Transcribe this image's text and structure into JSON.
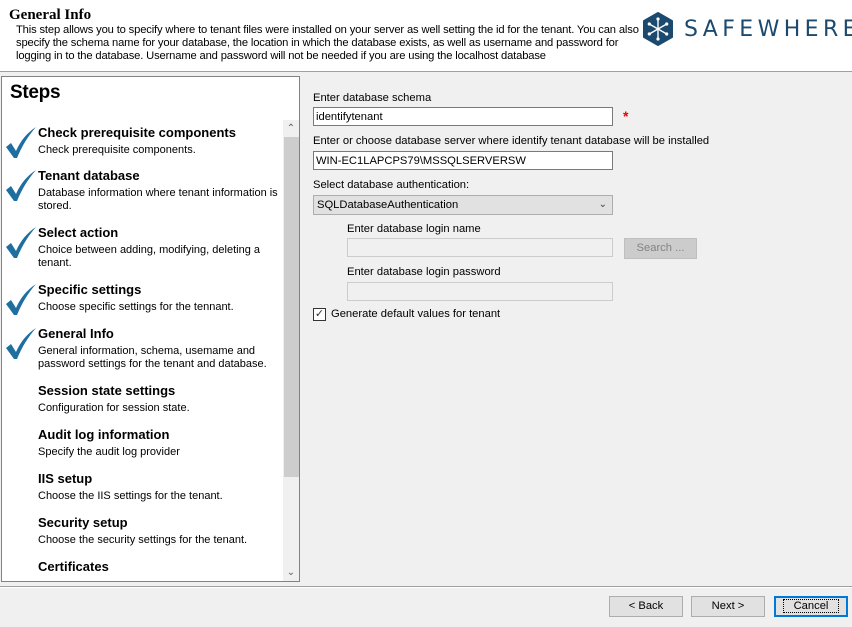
{
  "header": {
    "title": "General Info",
    "description": "This step allows you to specify where to tenant files were installed on your server as well setting the id for the tenant. You can also specify the schema name for your database, the location in which the database exists, as well as username and password for logging in to the database. Username and password will not be needed if you are using the localhost database",
    "logo_text": "SAFEWHERE",
    "logo_icon": "snowflake-hexagon-icon",
    "brand_color": "#1c4a6e"
  },
  "steps": {
    "title": "Steps",
    "check_color": "#1e6fa0",
    "items": [
      {
        "title": "Check prerequisite components",
        "description": "Check prerequisite components.",
        "completed": true
      },
      {
        "title": "Tenant database",
        "description": "Database information where tenant information is stored.",
        "completed": true
      },
      {
        "title": "Select action",
        "description": "Choice between adding, modifying, deleting a tenant.",
        "completed": true
      },
      {
        "title": "Specific settings",
        "description": "Choose specific settings for the tennant.",
        "completed": true
      },
      {
        "title": "General Info",
        "description": "General information, schema, usemame and password settings for the tenant and database.",
        "completed": true
      },
      {
        "title": "Session state settings",
        "description": "Configuration for session state.",
        "completed": false
      },
      {
        "title": "Audit log information",
        "description": "Specify the audit log provider",
        "completed": false
      },
      {
        "title": "IIS setup",
        "description": "Choose the IIS settings for the tenant.",
        "completed": false
      },
      {
        "title": "Security setup",
        "description": "Choose the security settings for the tenant.",
        "completed": false
      },
      {
        "title": "Certificates",
        "description": "",
        "completed": false
      }
    ]
  },
  "form": {
    "schema_label": "Enter database schema",
    "schema_value": "identifytenant",
    "required_marker": "*",
    "server_label": "Enter or choose database server where identify tenant database will be installed",
    "server_value": "WIN-EC1LAPCPS79\\MSSQLSERVERSW",
    "auth_label": "Select database authentication:",
    "auth_value": "SQLDatabaseAuthentication",
    "login_name_label": "Enter database login name",
    "login_name_value": "",
    "search_button": "Search ...",
    "login_password_label": "Enter database login password",
    "login_password_value": "",
    "generate_defaults_label": "Generate default values for tenant",
    "generate_defaults_checked": true
  },
  "footer": {
    "back": "< Back",
    "next": "Next >",
    "cancel": "Cancel"
  }
}
